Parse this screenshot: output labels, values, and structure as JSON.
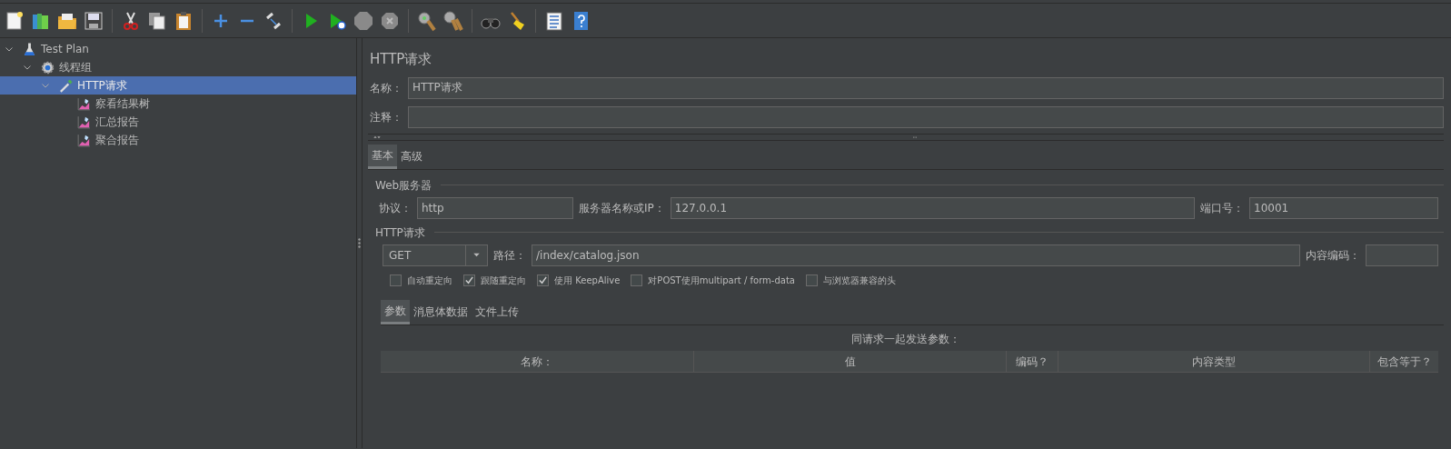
{
  "tree": [
    {
      "label": "Test Plan",
      "kind": "plan",
      "expanded": true,
      "selected": false,
      "children": [
        {
          "label": "线程组",
          "kind": "threads",
          "expanded": true,
          "selected": false,
          "children": [
            {
              "label": "HTTP请求",
              "kind": "sampler",
              "expanded": true,
              "selected": true,
              "children": [
                {
                  "label": "察看结果树",
                  "kind": "listener",
                  "selected": false
                },
                {
                  "label": "汇总报告",
                  "kind": "listener",
                  "selected": false
                },
                {
                  "label": "聚合报告",
                  "kind": "listener",
                  "selected": false
                }
              ]
            }
          ]
        }
      ]
    }
  ],
  "panel": {
    "title": "HTTP请求",
    "name_label": "名称：",
    "name_value": "HTTP请求",
    "comment_label": "注释：",
    "tabs": [
      {
        "label": "基本",
        "selected": true
      },
      {
        "label": "高级",
        "selected": false
      }
    ],
    "web_server": {
      "legend": "Web服务器",
      "protocol_label": "协议：",
      "protocol": "http",
      "server_label": "服务器名称或IP：",
      "server": "127.0.0.1",
      "port_label": "端口号：",
      "port": "10001"
    },
    "http_request": {
      "legend": "HTTP请求",
      "method": "GET",
      "path_label": "路径：",
      "path": "/index/catalog.json",
      "encoding_label": "内容编码："
    },
    "options": [
      {
        "label": "自动重定向",
        "checked": false
      },
      {
        "label": "跟随重定向",
        "checked": true
      },
      {
        "label": "使用 KeepAlive",
        "checked": true
      },
      {
        "label": "对POST使用multipart / form-data",
        "checked": false
      },
      {
        "label": "与浏览器兼容的头",
        "checked": false
      }
    ],
    "sub_tabs": [
      {
        "label": "参数",
        "selected": true
      },
      {
        "label": "消息体数据",
        "selected": false
      },
      {
        "label": "文件上传",
        "selected": false
      }
    ],
    "params_caption": "同请求一起发送参数：",
    "columns": [
      "名称：",
      "值",
      "编码？",
      "内容类型",
      "包含等于？"
    ]
  }
}
